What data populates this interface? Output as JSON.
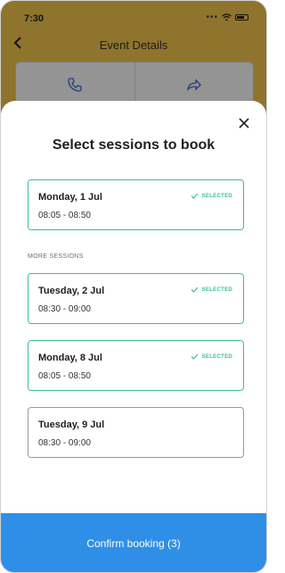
{
  "status_bar": {
    "time": "7:30",
    "signal_icon": "cellular-dots-icon",
    "wifi_icon": "wifi-icon",
    "battery_icon": "battery-icon"
  },
  "header": {
    "back_icon": "chevron-left-icon",
    "title": "Event Details"
  },
  "actions": [
    {
      "icon": "phone-icon"
    },
    {
      "icon": "share-icon"
    }
  ],
  "sheet": {
    "close_icon": "close-icon",
    "title": "Select sessions to book",
    "more_label": "MORE SESSIONS",
    "selected_label": "SELECTED",
    "sessions": [
      {
        "date": "Monday, 1 Jul",
        "time": "08:05 - 08:50",
        "selected": true
      },
      {
        "date": "Tuesday, 2 Jul",
        "time": "08:30 - 09:00",
        "selected": true
      },
      {
        "date": "Monday, 8 Jul",
        "time": "08:05 - 08:50",
        "selected": true
      },
      {
        "date": "Tuesday, 9 Jul",
        "time": "08:30 - 09:00",
        "selected": false
      }
    ],
    "confirm_label": "Confirm booking (3)"
  },
  "colors": {
    "header_bg": "#f7c84f",
    "accent_green": "#37c28a",
    "button_blue": "#2f8fe6"
  }
}
